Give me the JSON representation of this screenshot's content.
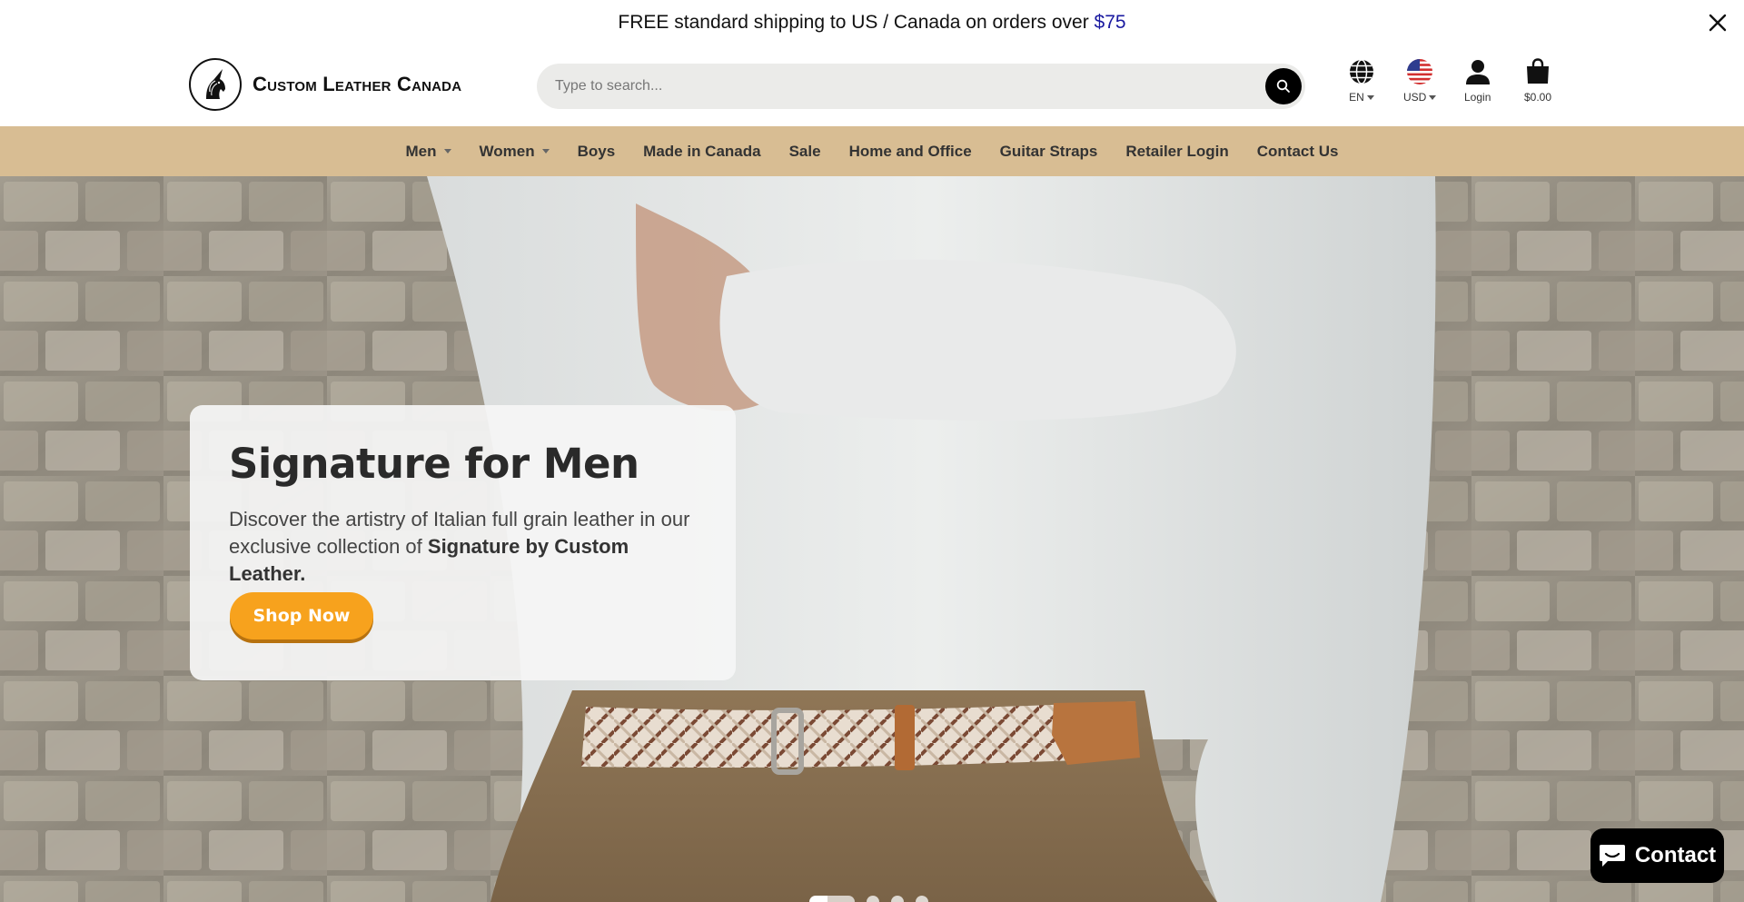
{
  "announcement": {
    "text": "FREE standard shipping to US / Canada on orders over ",
    "price": "$75"
  },
  "brand": {
    "name": "Custom Leather Canada"
  },
  "search": {
    "placeholder": "Type to search..."
  },
  "header": {
    "language": "EN",
    "currency": "USD",
    "login": "Login",
    "cart_total": "$0.00"
  },
  "nav": {
    "items": [
      {
        "label": "Men",
        "dropdown": true
      },
      {
        "label": "Women",
        "dropdown": true
      },
      {
        "label": "Boys",
        "dropdown": false
      },
      {
        "label": "Made in Canada",
        "dropdown": false
      },
      {
        "label": "Sale",
        "dropdown": false
      },
      {
        "label": "Home and Office",
        "dropdown": false
      },
      {
        "label": "Guitar Straps",
        "dropdown": false
      },
      {
        "label": "Retailer Login",
        "dropdown": false
      },
      {
        "label": "Contact Us",
        "dropdown": false
      }
    ]
  },
  "hero": {
    "title": "Signature for Men",
    "desc_part1": "Discover the artistry of Italian full grain leather in our exclusive collection of ",
    "desc_bold": "Signature by Custom Leather.",
    "button": "Shop Now",
    "slides": 4,
    "active_slide": 1
  },
  "chat": {
    "label": "Contact"
  },
  "colors": {
    "nav_bg": "#d8bd93",
    "cta": "#f7a21d",
    "price_link": "#1a1aa0"
  }
}
